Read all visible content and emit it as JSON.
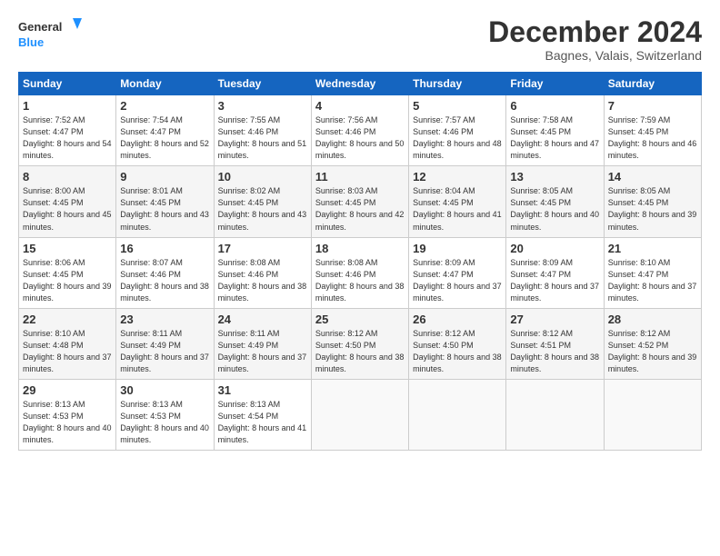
{
  "logo": {
    "line1": "General",
    "line2": "Blue"
  },
  "title": "December 2024",
  "subtitle": "Bagnes, Valais, Switzerland",
  "days_of_week": [
    "Sunday",
    "Monday",
    "Tuesday",
    "Wednesday",
    "Thursday",
    "Friday",
    "Saturday"
  ],
  "weeks": [
    [
      {
        "day": "1",
        "sunrise": "7:52 AM",
        "sunset": "4:47 PM",
        "daylight": "8 hours and 54 minutes."
      },
      {
        "day": "2",
        "sunrise": "7:54 AM",
        "sunset": "4:47 PM",
        "daylight": "8 hours and 52 minutes."
      },
      {
        "day": "3",
        "sunrise": "7:55 AM",
        "sunset": "4:46 PM",
        "daylight": "8 hours and 51 minutes."
      },
      {
        "day": "4",
        "sunrise": "7:56 AM",
        "sunset": "4:46 PM",
        "daylight": "8 hours and 50 minutes."
      },
      {
        "day": "5",
        "sunrise": "7:57 AM",
        "sunset": "4:46 PM",
        "daylight": "8 hours and 48 minutes."
      },
      {
        "day": "6",
        "sunrise": "7:58 AM",
        "sunset": "4:45 PM",
        "daylight": "8 hours and 47 minutes."
      },
      {
        "day": "7",
        "sunrise": "7:59 AM",
        "sunset": "4:45 PM",
        "daylight": "8 hours and 46 minutes."
      }
    ],
    [
      {
        "day": "8",
        "sunrise": "8:00 AM",
        "sunset": "4:45 PM",
        "daylight": "8 hours and 45 minutes."
      },
      {
        "day": "9",
        "sunrise": "8:01 AM",
        "sunset": "4:45 PM",
        "daylight": "8 hours and 43 minutes."
      },
      {
        "day": "10",
        "sunrise": "8:02 AM",
        "sunset": "4:45 PM",
        "daylight": "8 hours and 43 minutes."
      },
      {
        "day": "11",
        "sunrise": "8:03 AM",
        "sunset": "4:45 PM",
        "daylight": "8 hours and 42 minutes."
      },
      {
        "day": "12",
        "sunrise": "8:04 AM",
        "sunset": "4:45 PM",
        "daylight": "8 hours and 41 minutes."
      },
      {
        "day": "13",
        "sunrise": "8:05 AM",
        "sunset": "4:45 PM",
        "daylight": "8 hours and 40 minutes."
      },
      {
        "day": "14",
        "sunrise": "8:05 AM",
        "sunset": "4:45 PM",
        "daylight": "8 hours and 39 minutes."
      }
    ],
    [
      {
        "day": "15",
        "sunrise": "8:06 AM",
        "sunset": "4:45 PM",
        "daylight": "8 hours and 39 minutes."
      },
      {
        "day": "16",
        "sunrise": "8:07 AM",
        "sunset": "4:46 PM",
        "daylight": "8 hours and 38 minutes."
      },
      {
        "day": "17",
        "sunrise": "8:08 AM",
        "sunset": "4:46 PM",
        "daylight": "8 hours and 38 minutes."
      },
      {
        "day": "18",
        "sunrise": "8:08 AM",
        "sunset": "4:46 PM",
        "daylight": "8 hours and 38 minutes."
      },
      {
        "day": "19",
        "sunrise": "8:09 AM",
        "sunset": "4:47 PM",
        "daylight": "8 hours and 37 minutes."
      },
      {
        "day": "20",
        "sunrise": "8:09 AM",
        "sunset": "4:47 PM",
        "daylight": "8 hours and 37 minutes."
      },
      {
        "day": "21",
        "sunrise": "8:10 AM",
        "sunset": "4:47 PM",
        "daylight": "8 hours and 37 minutes."
      }
    ],
    [
      {
        "day": "22",
        "sunrise": "8:10 AM",
        "sunset": "4:48 PM",
        "daylight": "8 hours and 37 minutes."
      },
      {
        "day": "23",
        "sunrise": "8:11 AM",
        "sunset": "4:49 PM",
        "daylight": "8 hours and 37 minutes."
      },
      {
        "day": "24",
        "sunrise": "8:11 AM",
        "sunset": "4:49 PM",
        "daylight": "8 hours and 37 minutes."
      },
      {
        "day": "25",
        "sunrise": "8:12 AM",
        "sunset": "4:50 PM",
        "daylight": "8 hours and 38 minutes."
      },
      {
        "day": "26",
        "sunrise": "8:12 AM",
        "sunset": "4:50 PM",
        "daylight": "8 hours and 38 minutes."
      },
      {
        "day": "27",
        "sunrise": "8:12 AM",
        "sunset": "4:51 PM",
        "daylight": "8 hours and 38 minutes."
      },
      {
        "day": "28",
        "sunrise": "8:12 AM",
        "sunset": "4:52 PM",
        "daylight": "8 hours and 39 minutes."
      }
    ],
    [
      {
        "day": "29",
        "sunrise": "8:13 AM",
        "sunset": "4:53 PM",
        "daylight": "8 hours and 40 minutes."
      },
      {
        "day": "30",
        "sunrise": "8:13 AM",
        "sunset": "4:53 PM",
        "daylight": "8 hours and 40 minutes."
      },
      {
        "day": "31",
        "sunrise": "8:13 AM",
        "sunset": "4:54 PM",
        "daylight": "8 hours and 41 minutes."
      },
      null,
      null,
      null,
      null
    ]
  ]
}
